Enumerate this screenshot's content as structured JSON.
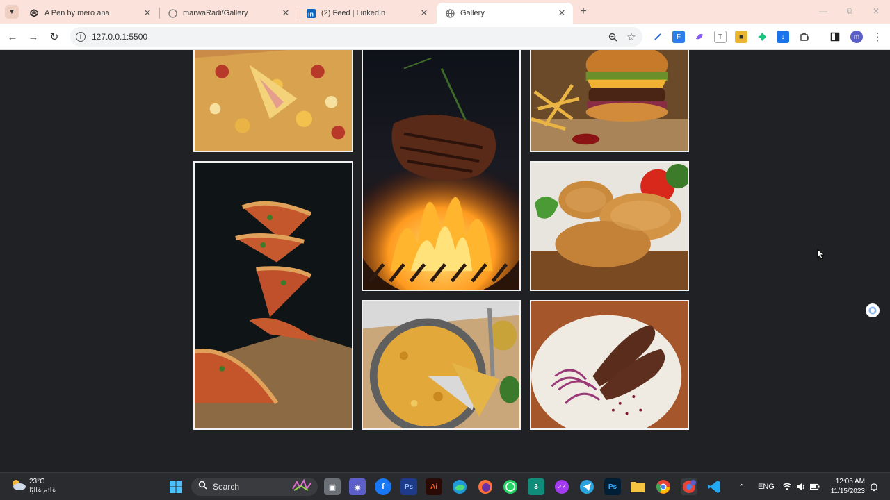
{
  "browser": {
    "tabs": [
      {
        "title": "A Pen by mero ana",
        "icon": "codepen-icon",
        "active": false
      },
      {
        "title": "marwaRadi/Gallery",
        "icon": "github-icon",
        "active": false
      },
      {
        "title": "(2) Feed | LinkedIn",
        "icon": "linkedin-icon",
        "active": false
      },
      {
        "title": "Gallery",
        "icon": "globe-icon",
        "active": true
      }
    ],
    "url": "127.0.0.1:5500",
    "profile_initial": "m"
  },
  "gallery": {
    "images": [
      {
        "subject": "pizza slice with cheese pull",
        "column": 1,
        "row": 1
      },
      {
        "subject": "grilled steak over flames",
        "column": 2,
        "row": 1
      },
      {
        "subject": "cheeseburger with fries",
        "column": 3,
        "row": 1
      },
      {
        "subject": "floating pizza slices",
        "column": 1,
        "row": 2
      },
      {
        "subject": "fried chicken",
        "column": 3,
        "row": 2
      },
      {
        "subject": "potato omelette tortilla",
        "column": 2,
        "row": 3
      },
      {
        "subject": "kofta kebab with onions",
        "column": 3,
        "row": 3
      }
    ]
  },
  "taskbar": {
    "weather_temp": "23°C",
    "weather_condition": "غائم غالبًا",
    "search_label": "Search",
    "language": "ENG",
    "time": "12:05 AM",
    "date": "11/15/2023"
  },
  "colors": {
    "page_background": "#202124",
    "tab_strip": "#fbe3db",
    "tile_border": "#f2f2f2"
  }
}
